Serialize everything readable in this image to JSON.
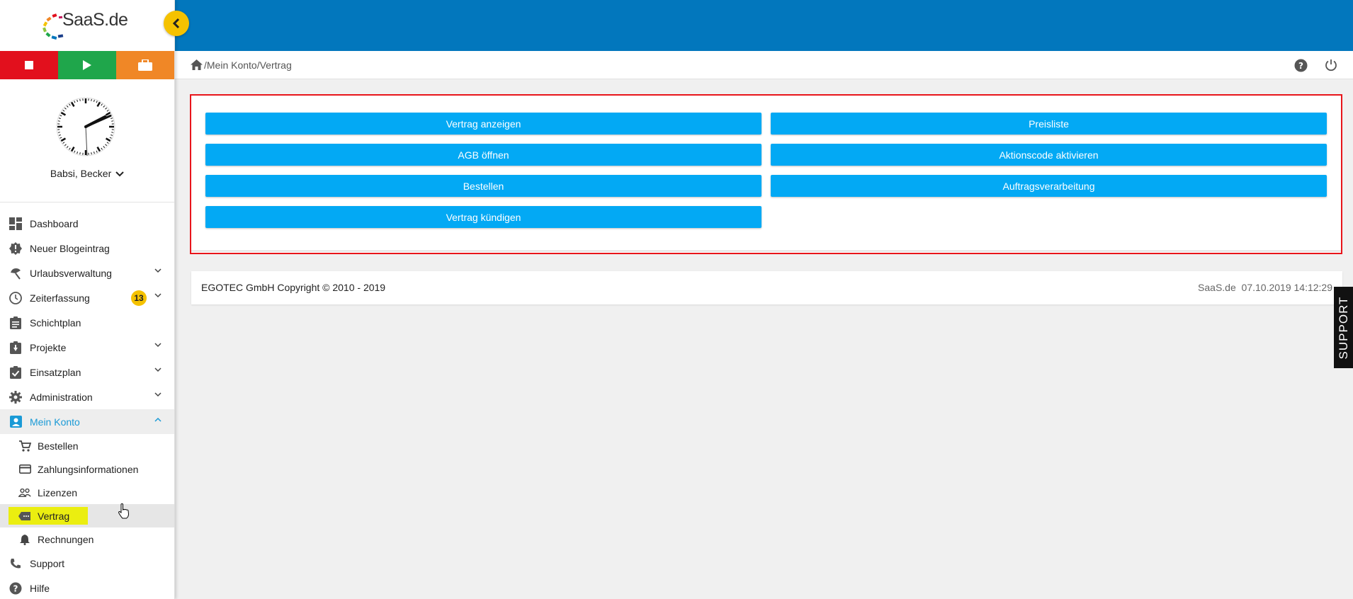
{
  "brand": {
    "logo_text": "SaaS.de"
  },
  "user": {
    "name": "Babsi, Becker"
  },
  "nav": {
    "dashboard": "Dashboard",
    "blog": "Neuer Blogeintrag",
    "urlaub": "Urlaubsverwaltung",
    "zeit": "Zeiterfassung",
    "zeit_badge": "13",
    "schicht": "Schichtplan",
    "projekte": "Projekte",
    "einsatz": "Einsatzplan",
    "admin": "Administration",
    "konto": "Mein Konto",
    "sub": {
      "bestellen": "Bestellen",
      "zahlung": "Zahlungsinformationen",
      "lizenzen": "Lizenzen",
      "vertrag": "Vertrag",
      "rechnungen": "Rechnungen"
    },
    "support": "Support",
    "hilfe": "Hilfe"
  },
  "breadcrumb": {
    "sep1": "/",
    "item1": "Mein Konto",
    "sep2": "/",
    "item2": "Vertrag"
  },
  "actions": {
    "vertrag_anzeigen": "Vertrag anzeigen",
    "preisliste": "Preisliste",
    "agb": "AGB öffnen",
    "aktionscode": "Aktionscode aktivieren",
    "bestellen": "Bestellen",
    "auftrag": "Auftragsverarbeitung",
    "kuendigen": "Vertrag kündigen"
  },
  "footer": {
    "copyright": "EGOTEC GmbH Copyright © 2010 - 2019",
    "brand_date": "SaaS.de  07.10.2019 14:12:29"
  },
  "support_tab": "SUPPORT",
  "colors": {
    "topbar": "#0277bd",
    "button": "#03a9f4",
    "accent": "#f5c200",
    "highlight": "#ebee10",
    "active_text": "#1a9ad6"
  }
}
